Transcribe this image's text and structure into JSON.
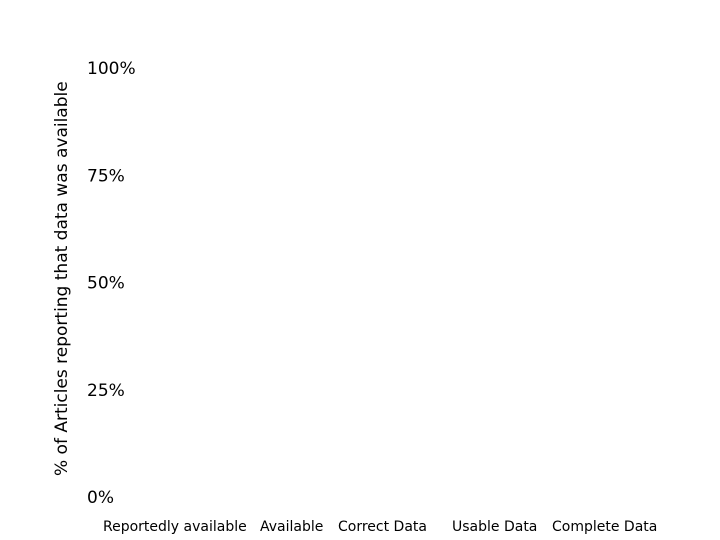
{
  "chart_data": {
    "type": "bar",
    "title": "",
    "xlabel": "",
    "ylabel": "% of Articles reporting that data was available",
    "categories": [
      "Reportedly available",
      "Available",
      "Correct Data",
      "Usable Data",
      "Complete Data"
    ],
    "series": [
      {
        "name": "",
        "values": [
          null,
          null,
          null,
          null,
          null
        ]
      }
    ],
    "yticks": [
      "0%",
      "25%",
      "50%",
      "75%",
      "100%"
    ],
    "ytick_values": [
      0,
      25,
      50,
      75,
      100
    ],
    "ylim": [
      0,
      100
    ],
    "grid": false,
    "legend": "none",
    "colors": {
      "text": "#000000",
      "background": "#ffffff"
    }
  }
}
